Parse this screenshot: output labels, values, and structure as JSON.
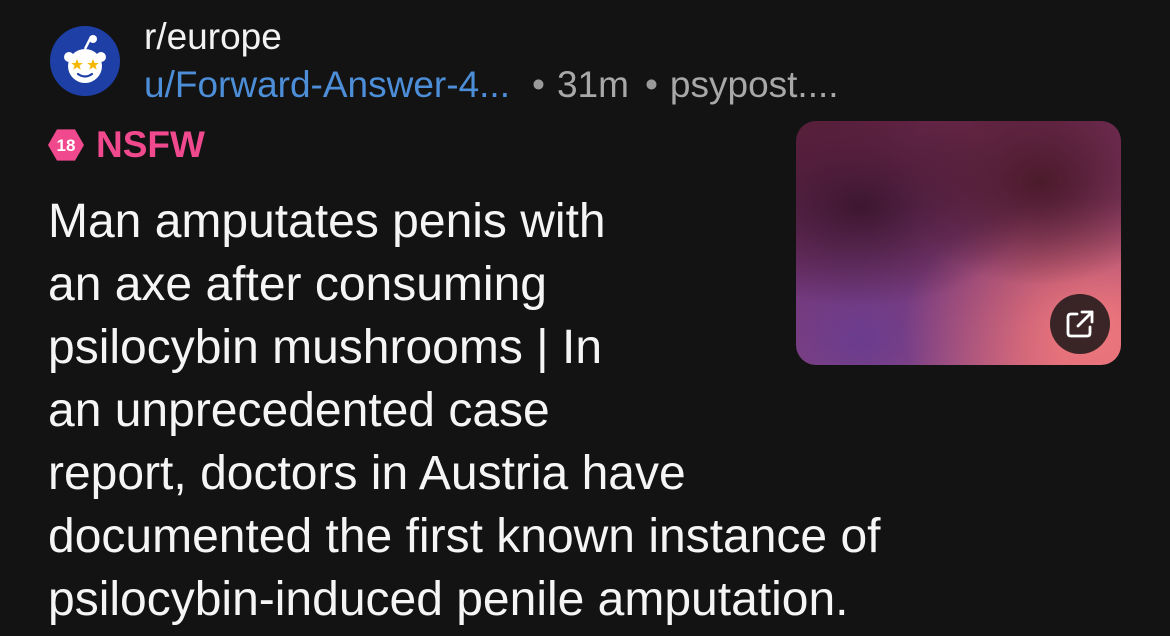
{
  "post": {
    "subreddit": "r/europe",
    "author": "u/Forward-Answer-4...",
    "separator": "•",
    "age": "31m",
    "domain": "psypost....",
    "nsfw_label": "NSFW",
    "nsfw_badge_text": "18",
    "title_lines": [
      "Man amputates penis with",
      "an axe after consuming",
      "psilocybin mushrooms | In",
      "an unprecedented case",
      "report, doctors in Austria have",
      "documented the first known instance of",
      "psilocybin-induced penile amputation."
    ]
  },
  "icons": {
    "avatar": "subreddit-avatar-icon",
    "nsfw": "nsfw-18-icon",
    "external_link": "external-link-icon"
  },
  "colors": {
    "background": "#131313",
    "author_link": "#4d8ed8",
    "nsfw_accent": "#f0498e",
    "avatar_bg": "#1d3fa6"
  }
}
